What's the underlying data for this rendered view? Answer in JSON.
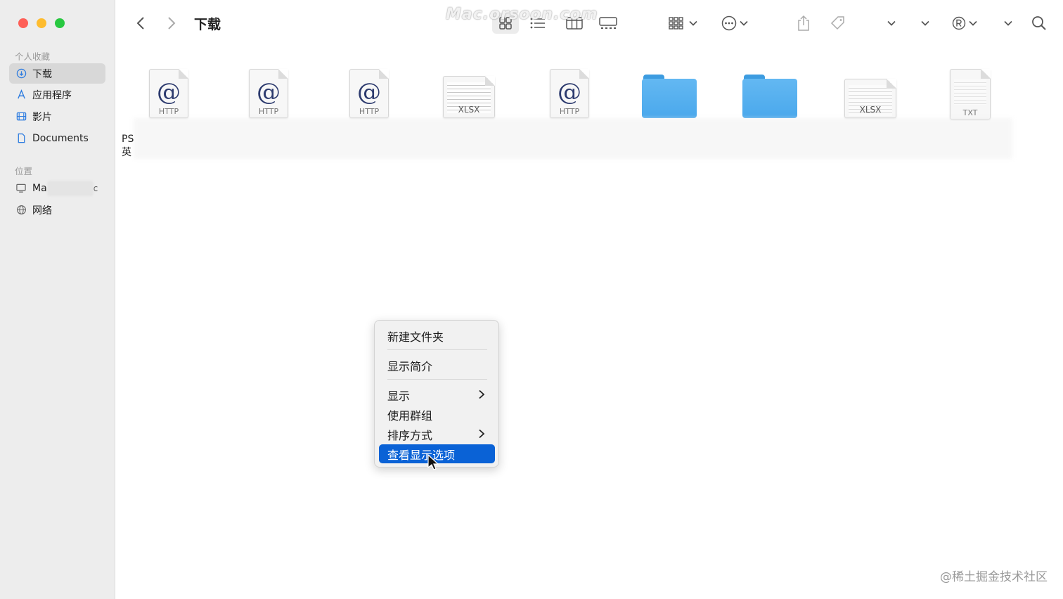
{
  "window": {
    "title": "下载",
    "watermark": "Mac.orsoon.com"
  },
  "sidebar": {
    "favorites_header": "个人收藏",
    "favorites": [
      {
        "label": "下载",
        "icon": "download-icon",
        "selected": true
      },
      {
        "label": "应用程序",
        "icon": "applications-icon"
      },
      {
        "label": "影片",
        "icon": "film-icon"
      },
      {
        "label": "Documents",
        "icon": "document-icon"
      }
    ],
    "locations_header": "位置",
    "locations": [
      {
        "label_prefix": "Ma",
        "label_suffix": "c",
        "icon": "computer-icon"
      },
      {
        "label": "网络",
        "icon": "network-icon"
      }
    ]
  },
  "files": [
    {
      "type": "http",
      "ext": "HTTP"
    },
    {
      "type": "http",
      "ext": "HTTP"
    },
    {
      "type": "http",
      "ext": "HTTP"
    },
    {
      "type": "xlsx",
      "ext": "XLSX"
    },
    {
      "type": "http",
      "ext": "HTTP"
    },
    {
      "type": "folder"
    },
    {
      "type": "folder"
    },
    {
      "type": "xlsx",
      "ext": "XLSX"
    },
    {
      "type": "txt",
      "ext": "TXT"
    }
  ],
  "partial_label": {
    "line1": "PS",
    "line2": "英"
  },
  "context_menu": {
    "items": [
      {
        "label": "新建文件夹",
        "submenu": false,
        "active": false
      },
      {
        "label": "显示简介",
        "submenu": false,
        "active": false
      },
      {
        "label": "显示",
        "submenu": true,
        "active": false
      },
      {
        "label": "使用群组",
        "submenu": false,
        "active": false
      },
      {
        "label": "排序方式",
        "submenu": true,
        "active": false
      },
      {
        "label": "查看显示选项",
        "submenu": false,
        "active": true
      }
    ]
  },
  "credit": "@稀土掘金技术社区",
  "colors": {
    "accent": "#0a62d6",
    "folder": "#4aa8ec",
    "close": "#fe5f57",
    "minimize": "#febc2e",
    "zoom": "#28c840"
  }
}
